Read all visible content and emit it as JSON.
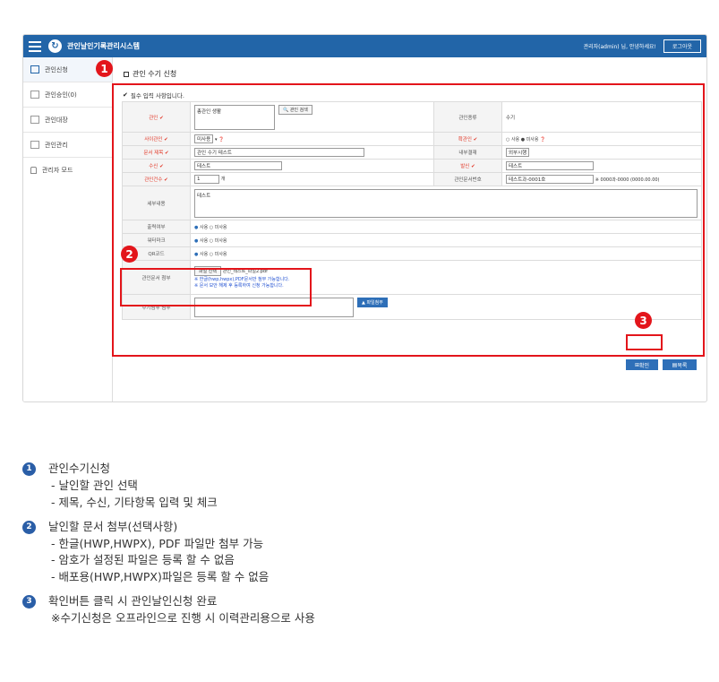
{
  "header": {
    "app_title": "관인날인기록관리시스템",
    "greeting": "관리자(admin) 님, 안녕하세요!",
    "logout": "로그아웃"
  },
  "sidebar": {
    "items": [
      {
        "label": "관인신청"
      },
      {
        "label": "관인승인(0)"
      },
      {
        "label": "관인대장"
      },
      {
        "label": "관인관리"
      },
      {
        "label": "관리자 모드"
      }
    ]
  },
  "page": {
    "title": "관인 수기 신청",
    "required_note": "필수 입력 사항입니다."
  },
  "form": {
    "seal_label": "관인",
    "seal_value": "총관인 생활",
    "seal_search": "관인 검색",
    "seal_type_label": "관인종류",
    "seal_type_value": "수기",
    "urgent_label": "사이관인",
    "urgent_value": "미사용",
    "confirm_label": "확관인",
    "confirm_opt1": "사용",
    "confirm_opt2": "미사용",
    "doc_title_label": "문서 제목",
    "doc_title_value": "관인 수기 테스트",
    "internal_label": "내부결재",
    "internal_value": "외부시행",
    "recv_label": "수신",
    "recv_value": "테스트",
    "send_label": "발신",
    "send_value": "테스트",
    "count_label": "관인건수",
    "count_value": "1",
    "count_unit": "개",
    "docno_label": "관인문서번호",
    "docno_value": "테스트과-0001호",
    "docno_hint": "※ 0000과-0000 (0000.00.00)",
    "detail_label": "세부내용",
    "detail_value": "테스트",
    "print_label": "출력여부",
    "water_label": "워터마크",
    "qr_label": "QR코드",
    "opt_use": "사용",
    "opt_nouse": "미사용",
    "attach_label": "관인문서 첨부",
    "file_btn": "파일 선택",
    "file_names": "관인_테스트_파일2.pdf",
    "attach_note1": "※ 한글(hwp,hwpx),PDF문서만 첨부 가능합니다.",
    "attach_note2": "※ 문서 보안 해제 후 등록하여 신청 가능합니다.",
    "manual_label": "수기첨부 첨부",
    "manual_btn": "파일첨부"
  },
  "actions": {
    "confirm": "확인",
    "list": "목록"
  },
  "badges": [
    "1",
    "2",
    "3"
  ],
  "notes": [
    {
      "num": "1",
      "title": "관인수기신청",
      "lines": [
        "- 날인할 관인 선택",
        "- 제목, 수신, 기타항목 입력 및 체크"
      ]
    },
    {
      "num": "2",
      "title": "날인할 문서 첨부(선택사항)",
      "lines": [
        "- 한글(HWP,HWPX), PDF 파일만 첨부 가능",
        "- 암호가 설정된 파일은 등록 할 수 없음",
        "- 배포용(HWP,HWPX)파일은 등록 할 수 없음"
      ]
    },
    {
      "num": "3",
      "title": "확인버튼 클릭 시 관인날인신청 완료",
      "lines": [
        "※수기신청은 오프라인으로 진행 시 이력관리용으로 사용"
      ]
    }
  ]
}
